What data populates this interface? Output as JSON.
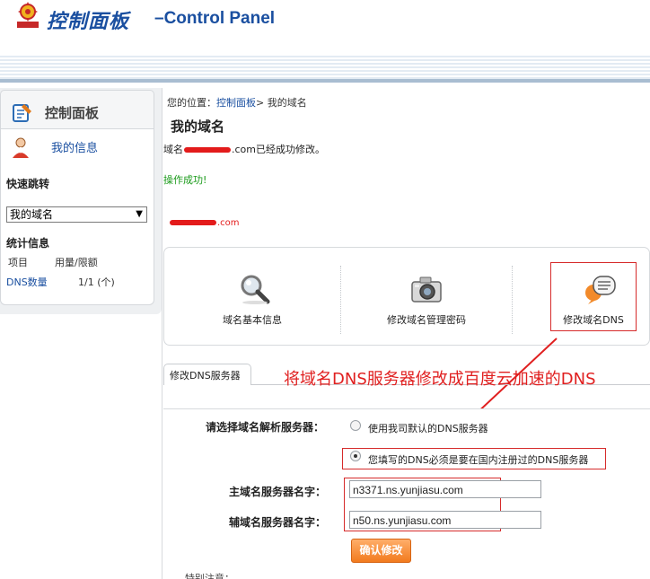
{
  "header": {
    "title_cn": "控制面板",
    "title_en": "–Control Panel"
  },
  "sidebar": {
    "title": "控制面板",
    "my_info": "我的信息",
    "quick_jump_label": "快速跳转",
    "quick_jump_selected": "我的域名",
    "stats_label": "统计信息",
    "stats_headers": [
      "项目",
      "用量/限额"
    ],
    "stats_rows": [
      {
        "name": "DNS数量",
        "value": "1/1 (个)"
      }
    ]
  },
  "breadcrumb": {
    "prefix": "您的位置：",
    "link": "控制面板",
    "separator": ">",
    "current": "我的域名"
  },
  "page": {
    "title": "我的域名",
    "msg_prefix": "域名",
    "msg_suffix": ".com已经成功修改。",
    "success": "操作成功!",
    "domain_suffix": ".com"
  },
  "tools": [
    {
      "label": "域名基本信息",
      "icon": "magnifier-icon"
    },
    {
      "label": "修改域名管理密码",
      "icon": "camera-icon"
    },
    {
      "label": "修改域名DNS",
      "icon": "speech-bubble-icon"
    }
  ],
  "dns": {
    "tab": "修改DNS服务器",
    "annotation": "将域名DNS服务器修改成百度云加速的DNS",
    "choose_label": "请选择域名解析服务器：",
    "option_default": "使用我司默认的DNS服务器",
    "option_custom": "您填写的DNS必须是要在国内注册过的DNS服务器",
    "primary_label": "主域名服务器名字：",
    "primary_value": "n3371.ns.yunjiasu.com",
    "secondary_label": "辅域名服务器名字：",
    "secondary_value": "n50.ns.yunjiasu.com",
    "confirm": "确认修改",
    "special_note": "特别注意："
  },
  "colors": {
    "brand": "#1a4fa0",
    "annotation": "#e02020",
    "success": "#1a9a1a",
    "button": "#f27b1e"
  }
}
